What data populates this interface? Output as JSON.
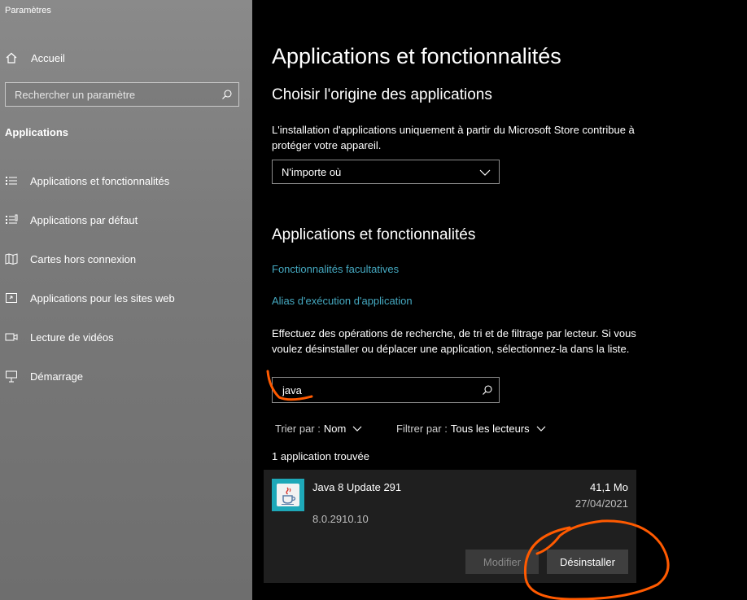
{
  "window": {
    "title": "Paramètres"
  },
  "sidebar": {
    "home_label": "Accueil",
    "search_placeholder": "Rechercher un paramètre",
    "section_title": "Applications",
    "items": [
      {
        "label": "Applications et fonctionnalités",
        "icon": "apps-features-icon"
      },
      {
        "label": "Applications par défaut",
        "icon": "default-apps-icon"
      },
      {
        "label": "Cartes hors connexion",
        "icon": "offline-maps-icon"
      },
      {
        "label": "Applications pour les sites web",
        "icon": "apps-websites-icon"
      },
      {
        "label": "Lecture de vidéos",
        "icon": "video-playback-icon"
      },
      {
        "label": "Démarrage",
        "icon": "startup-icon"
      }
    ]
  },
  "main": {
    "title": "Applications et fonctionnalités",
    "origin": {
      "heading": "Choisir l'origine des applications",
      "description": "L'installation d'applications uniquement à partir du Microsoft Store contribue à protéger votre appareil.",
      "dropdown_value": "N'importe où"
    },
    "apps": {
      "heading": "Applications et fonctionnalités",
      "link_optional": "Fonctionnalités facultatives",
      "link_alias": "Alias d'exécution d'application",
      "description": "Effectuez des opérations de recherche, de tri et de filtrage par lecteur. Si vous voulez désinstaller ou déplacer une application, sélectionnez-la dans la liste.",
      "search_value": "java",
      "sort_label": "Trier par :",
      "sort_value": "Nom",
      "filter_label": "Filtrer par :",
      "filter_value": "Tous les lecteurs",
      "count_text": "1 application trouvée"
    },
    "app_item": {
      "name": "Java 8 Update 291",
      "size": "41,1 Mo",
      "date": "27/04/2021",
      "version": "8.0.2910.10",
      "modify_label": "Modifier",
      "uninstall_label": "Désinstaller"
    }
  },
  "colors": {
    "link": "#45a9c1",
    "annotation": "#ff5a00",
    "app_icon_bg": "#1ea8b8"
  }
}
